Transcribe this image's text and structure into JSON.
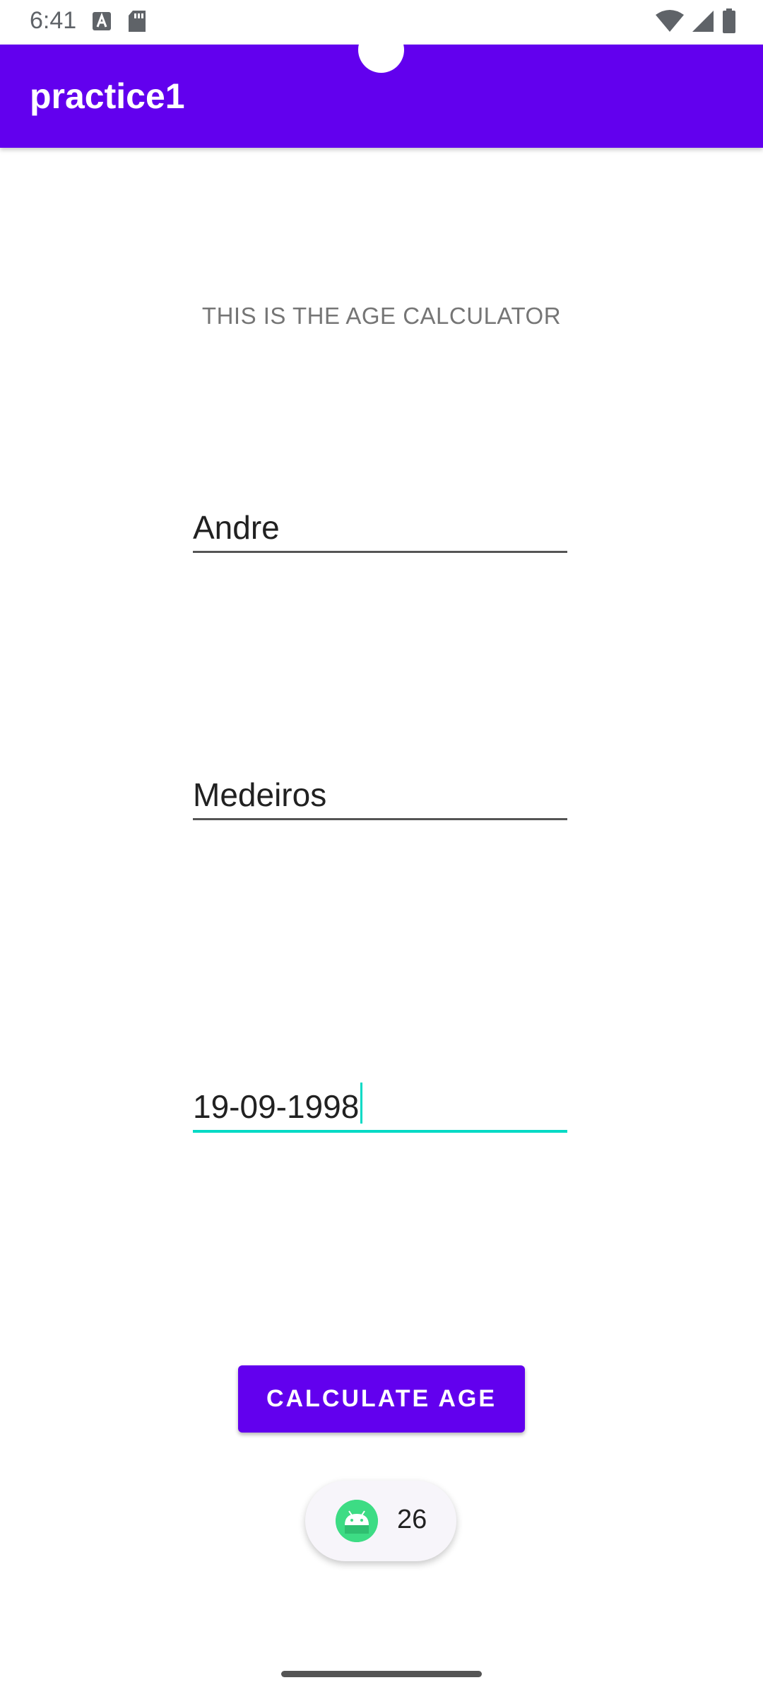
{
  "status_bar": {
    "time": "6:41",
    "icons": [
      "font-icon",
      "sd-card-icon",
      "wifi-icon",
      "signal-icon",
      "battery-icon"
    ]
  },
  "app_bar": {
    "title": "practice1",
    "color": "#6200ee"
  },
  "main": {
    "heading": "THIS IS THE AGE CALCULATOR",
    "fields": [
      {
        "value": "Andre",
        "focused": false
      },
      {
        "value": "Medeiros",
        "focused": false
      },
      {
        "value": "19-09-1998",
        "focused": true
      }
    ],
    "button_label": "CALCULATE AGE"
  },
  "toast": {
    "icon": "android-icon",
    "text": "26"
  },
  "colors": {
    "accent": "#03dac5",
    "primary": "#6200ee"
  }
}
